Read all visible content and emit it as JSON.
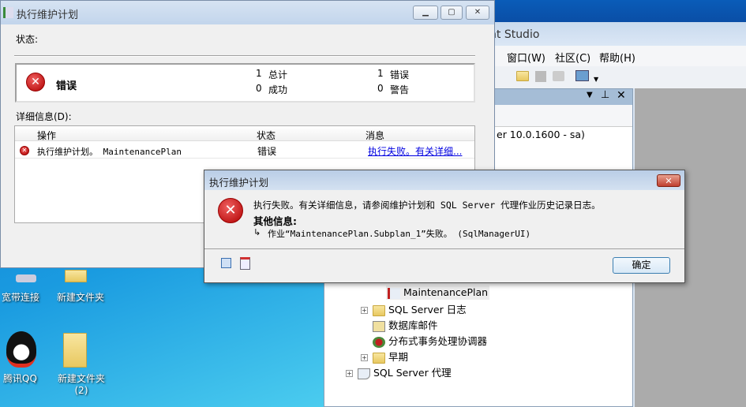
{
  "ssms": {
    "title_fragment": "nt Studio",
    "menu": [
      "窗口(W)",
      "社区(C)",
      "帮助(H)"
    ],
    "server_fragment": "er 10.0.1600 - sa)",
    "tree": [
      {
        "label": "MaintenancePlan",
        "selected": true
      },
      {
        "label": "SQL Server 日志",
        "expandable": true
      },
      {
        "label": "数据库邮件"
      },
      {
        "label": "分布式事务处理协调器"
      },
      {
        "label": "早期",
        "expandable": true
      },
      {
        "label": "SQL Server 代理",
        "expandable": true
      }
    ]
  },
  "exec_window": {
    "title": "执行维护计划",
    "status_label": "状态:",
    "result": "错误",
    "counts": {
      "total_n": "1",
      "total_label": "总计",
      "success_n": "0",
      "success_label": "成功",
      "error_n": "1",
      "error_label": "错误",
      "warning_n": "0",
      "warning_label": "警告"
    },
    "details_label": "详细信息(D):",
    "columns": [
      "操作",
      "状态",
      "消息"
    ],
    "rows": [
      {
        "action": "执行维护计划。 MaintenancePlan",
        "status": "错误",
        "message": "执行失败。有关详细..."
      }
    ]
  },
  "dialog": {
    "title": "执行维护计划",
    "message": "执行失败。有关详细信息，请参阅维护计划和 SQL Server 代理作业历史记录日志。",
    "more_info_label": "其他信息:",
    "detail": "作业“MaintenancePlan.Subplan_1”失败。 (SqlManagerUI)",
    "ok": "确定"
  },
  "desktop": {
    "icons": [
      "宽带连接",
      "新建文件夹",
      "腾讯QQ",
      "新建文件夹\n(2)"
    ]
  }
}
